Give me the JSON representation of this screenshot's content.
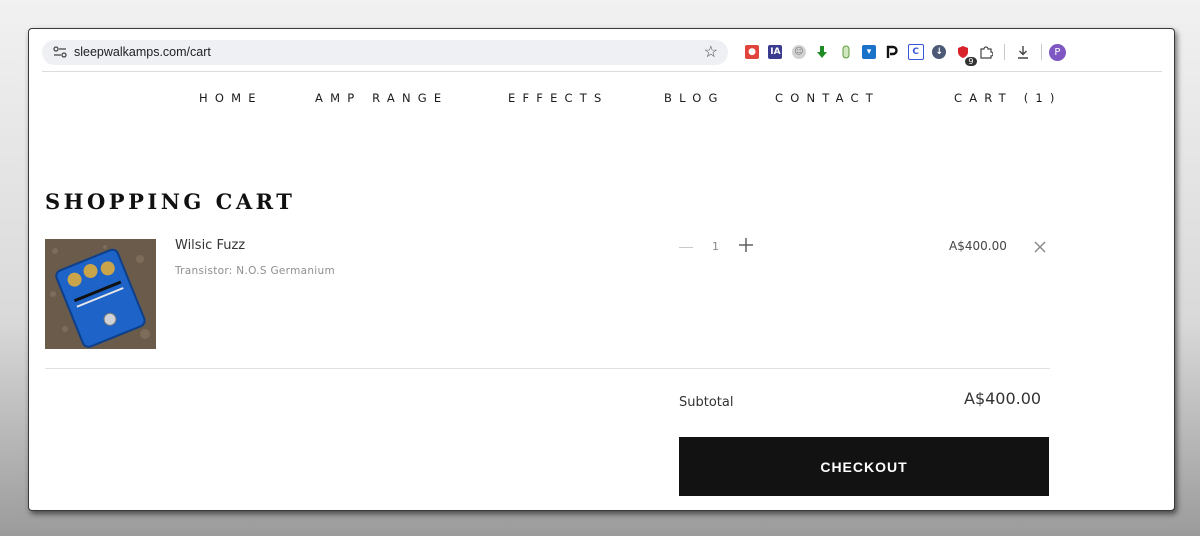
{
  "browser": {
    "url": "sleepwalkamps.com/cart",
    "extensions": [
      {
        "icon": "camera-extension-icon",
        "color": "#e0443c",
        "text": ""
      },
      {
        "icon": "ia-extension-icon",
        "color": "#3b3b8f",
        "text": "IA"
      },
      {
        "icon": "face-extension-icon",
        "color": "#b9b9b9",
        "text": ""
      },
      {
        "icon": "download-arrow-extension-icon",
        "color": "#1f8b24",
        "text": ""
      },
      {
        "icon": "capsule-extension-icon",
        "color": "#7ab648",
        "text": ""
      },
      {
        "icon": "save-extension-icon",
        "color": "#1a73c9",
        "text": ""
      },
      {
        "icon": "p-extension-icon",
        "color": "#111111",
        "text": ""
      },
      {
        "icon": "c-extension-icon",
        "color": "#3b57d6",
        "text": "C"
      },
      {
        "icon": "download-circle-extension-icon",
        "color": "#4c5a75",
        "text": ""
      },
      {
        "icon": "shield-extension-icon",
        "color": "#d8232a",
        "text": "",
        "badge": "9"
      },
      {
        "icon": "puzzle-extensions-icon",
        "color": "#555555",
        "text": ""
      }
    ],
    "profile_initial": "P"
  },
  "nav": {
    "home": "HOME",
    "amp_range": "AMP RANGE",
    "effects": "EFFECTS",
    "blog": "BLOG",
    "contact": "CONTACT",
    "cart": "CART (1)"
  },
  "page": {
    "title": "SHOPPING CART"
  },
  "cart": {
    "item": {
      "name": "Wilsic Fuzz",
      "variant": "Transistor: N.O.S Germanium",
      "quantity": "1",
      "price": "A$400.00"
    },
    "subtotal_label": "Subtotal",
    "subtotal_value": "A$400.00",
    "checkout_label": "CHECKOUT"
  }
}
